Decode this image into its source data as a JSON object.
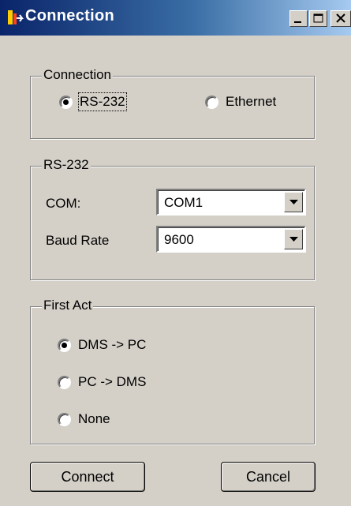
{
  "window": {
    "title": "Connection",
    "controls": {
      "minimize": "minimize",
      "maximize": "maximize",
      "close": "close"
    }
  },
  "connection_group": {
    "legend": "Connection",
    "options": [
      {
        "label": "RS-232",
        "selected": true
      },
      {
        "label": "Ethernet",
        "selected": false
      }
    ]
  },
  "rs232_group": {
    "legend": "RS-232",
    "com": {
      "label": "COM:",
      "value": "COM1"
    },
    "baud": {
      "label": "Baud Rate",
      "value": "9600"
    }
  },
  "first_act_group": {
    "legend": "First Act",
    "options": [
      {
        "label": "DMS -> PC",
        "selected": true
      },
      {
        "label": "PC -> DMS",
        "selected": false
      },
      {
        "label": "None",
        "selected": false
      }
    ]
  },
  "buttons": {
    "connect": "Connect",
    "cancel": "Cancel"
  },
  "colors": {
    "titlebar_start": "#0a246a",
    "titlebar_end": "#a6caf0",
    "face": "#d4d0c8"
  }
}
